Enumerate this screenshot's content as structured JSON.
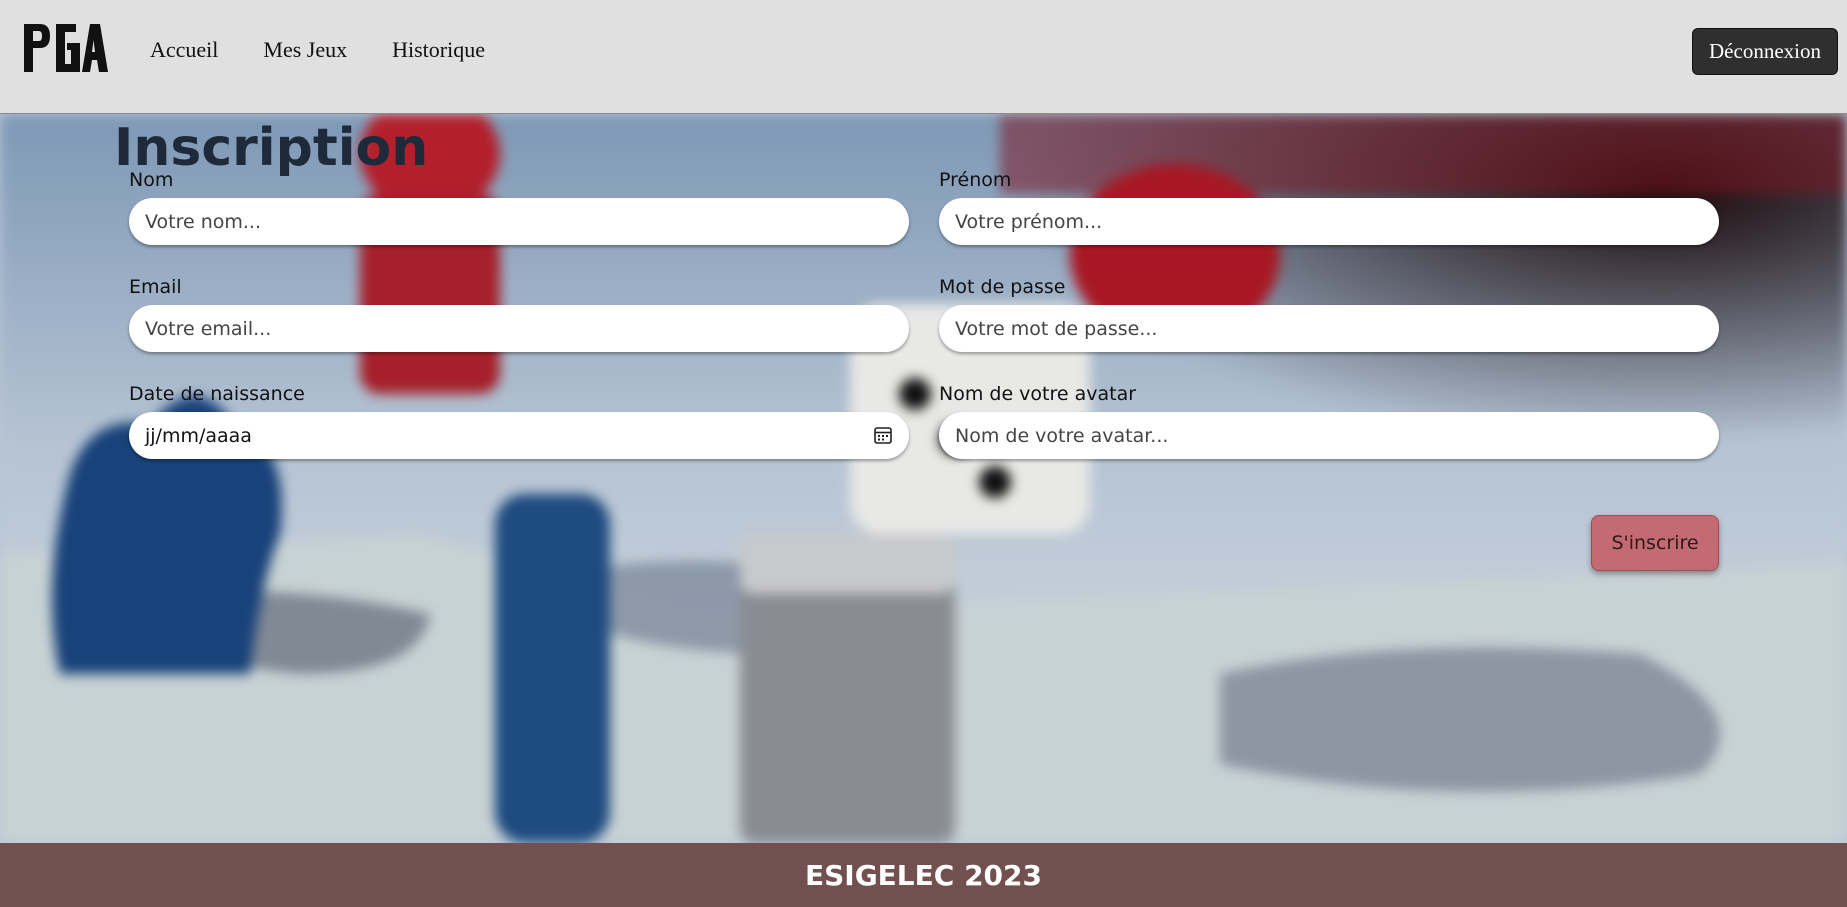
{
  "header": {
    "logo_text": "PGA",
    "nav": [
      {
        "label": "Accueil"
      },
      {
        "label": "Mes Jeux"
      },
      {
        "label": "Historique"
      }
    ],
    "logout_label": "Déconnexion"
  },
  "form": {
    "title": "Inscription",
    "fields": {
      "nom": {
        "label": "Nom",
        "placeholder": "Votre nom..."
      },
      "prenom": {
        "label": "Prénom",
        "placeholder": "Votre prénom..."
      },
      "email": {
        "label": "Email",
        "placeholder": "Votre email..."
      },
      "password": {
        "label": "Mot de passe",
        "placeholder": "Votre mot de passe..."
      },
      "birthdate": {
        "label": "Date de naissance",
        "value": "jj/mm/aaaa"
      },
      "avatar": {
        "label": "Nom de votre avatar",
        "placeholder": "Nom de votre avatar..."
      }
    },
    "submit_label": "S'inscrire"
  },
  "footer": {
    "text": "ESIGELEC 2023"
  },
  "colors": {
    "header_bg": "#e0e0e0",
    "logout_bg": "#2f2f2f",
    "submit_bg": "#c46a72",
    "footer_bg": "#735050"
  },
  "icons": {
    "calendar": "calendar-icon"
  }
}
